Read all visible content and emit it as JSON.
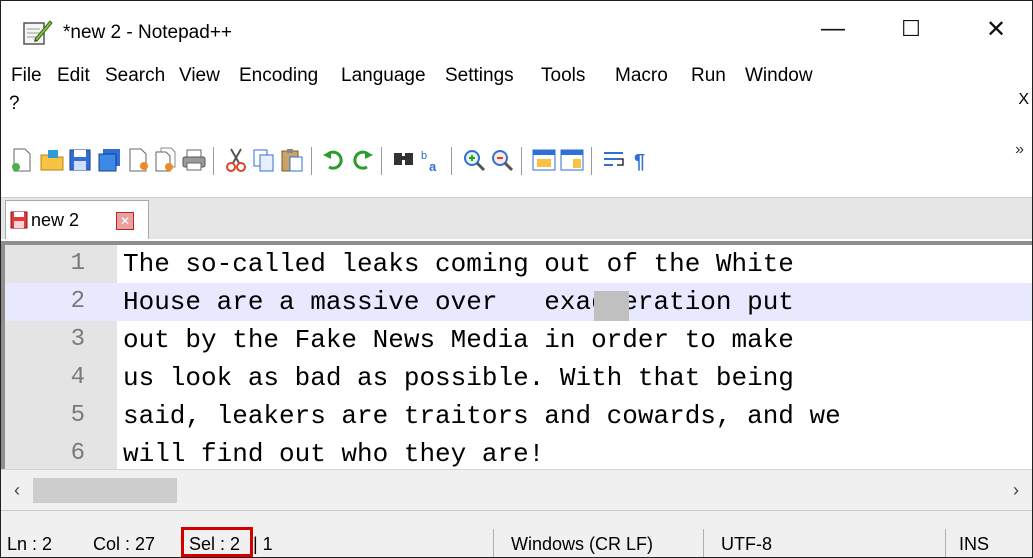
{
  "window": {
    "title": "*new 2 - Notepad++",
    "minimize": "—",
    "maximize": "☐",
    "close": "✕"
  },
  "menu": [
    "File",
    "Edit",
    "Search",
    "View",
    "Encoding",
    "Language",
    "Settings",
    "Tools",
    "Macro",
    "Run",
    "Window",
    "?"
  ],
  "menu_close": "X",
  "toolbar": {
    "icons": [
      "new-file-icon",
      "open-file-icon",
      "save-icon",
      "save-all-icon",
      "close-icon",
      "close-all-icon",
      "print-icon",
      "cut-icon",
      "copy-icon",
      "paste-icon",
      "undo-icon",
      "redo-icon",
      "find-icon",
      "replace-icon",
      "zoom-in-icon",
      "zoom-out-icon",
      "sync-vertical-icon",
      "sync-horizontal-icon",
      "word-wrap-icon",
      "show-all-characters-icon"
    ],
    "more": "»"
  },
  "tab": {
    "label": "new 2",
    "close": "✕"
  },
  "editor": {
    "lines": [
      {
        "num": "1",
        "text": "The so-called leaks coming out of the White"
      },
      {
        "num": "2",
        "text": "House are a massive over   exaggeration put"
      },
      {
        "num": "3",
        "text": "out by the Fake News Media in order to make"
      },
      {
        "num": "4",
        "text": "us look as bad as possible. With that being"
      },
      {
        "num": "5",
        "text": "said, leakers are traitors and cowards, and we"
      },
      {
        "num": "6",
        "text": "will find out who they are!"
      }
    ],
    "current_line": 2
  },
  "scrollbar": {
    "left": "‹",
    "right": "›"
  },
  "status": {
    "ln": "Ln : 2",
    "col": "Col : 27",
    "sel": "Sel : 2",
    "sel_extra": "| 1",
    "eol": "Windows (CR LF)",
    "encoding": "UTF-8",
    "mode": "INS"
  },
  "colors": {
    "current_line": "#e8e8ff",
    "highlight_box": "#d40000"
  }
}
